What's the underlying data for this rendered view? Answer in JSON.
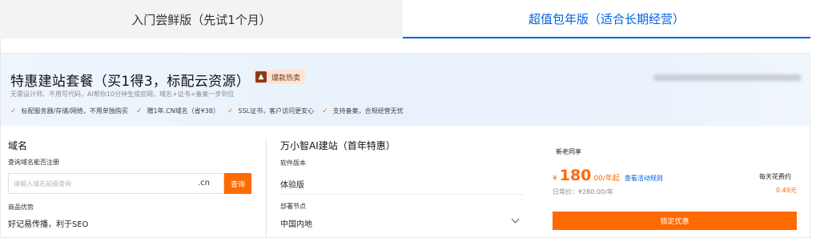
{
  "tabs": [
    {
      "label": "入门尝鲜版（先试1个月）",
      "active": false
    },
    {
      "label": "超值包年版（适合长期经营）",
      "active": true
    }
  ],
  "banner": {
    "title": "特惠建站套餐（买1得3，标配云资源）",
    "hot_badge": "爆款热卖",
    "subtitle": "无需设计师、不用写代码，AI帮你10分钟生成官网，域名+证书+备案一步到位",
    "features": [
      "标配服务器/存储/网络，不用单独购买",
      "赠1年.CN域名（省¥38）",
      "SSL证书，客户访问更安心",
      "支持备案，合规经营无忧"
    ]
  },
  "domain_section": {
    "title": "域名",
    "query_label": "查询域名能否注册",
    "search_placeholder": "请输入域名前缀查询",
    "suffix": ".cn",
    "query_button": "查询",
    "advantage_label": "商品优势",
    "advantage_value": "好记易传播，利于SEO"
  },
  "site_section": {
    "title": "万小智AI建站（首年特惠）",
    "version_label": "软件版本",
    "version_value": "体验版",
    "node_label": "部署节点",
    "node_value": "中国内地"
  },
  "purchase": {
    "badge": "新老同享",
    "currency": "¥",
    "price": "180",
    "unit": "00/年起",
    "rule_link": "查看活动规则",
    "daily_label": "每天花费约",
    "daily_value": "0.49元",
    "original_price": "日常价：¥280.00/年",
    "buy_button": "锁定优惠"
  },
  "colors": {
    "accent_blue": "#0063e6",
    "accent_orange": "#ff6a00"
  }
}
